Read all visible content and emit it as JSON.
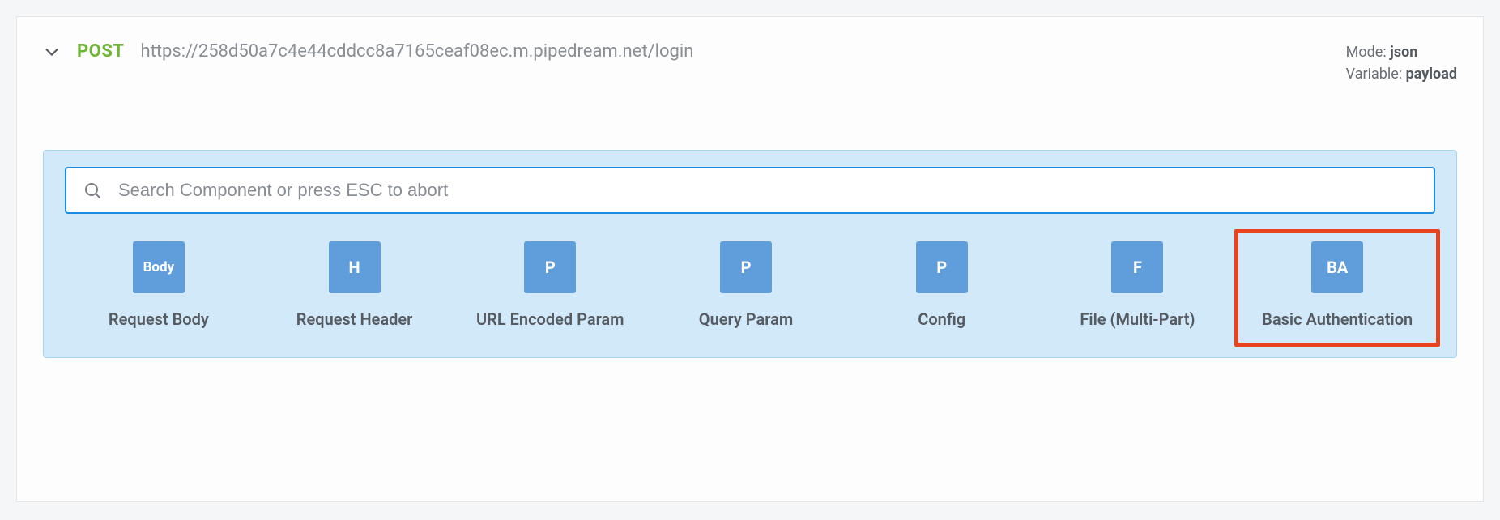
{
  "header": {
    "method": "POST",
    "url": "https://258d50a7c4e44cddcc8a7165ceaf08ec.m.pipedream.net/login",
    "mode_label": "Mode: ",
    "mode_value": "json",
    "variable_label": "Variable: ",
    "variable_value": "payload"
  },
  "search": {
    "placeholder": "Search Component or press ESC to abort"
  },
  "components": [
    {
      "badge": "Body",
      "label": "Request Body"
    },
    {
      "badge": "H",
      "label": "Request Header"
    },
    {
      "badge": "P",
      "label": "URL Encoded Param"
    },
    {
      "badge": "P",
      "label": "Query Param"
    },
    {
      "badge": "P",
      "label": "Config"
    },
    {
      "badge": "F",
      "label": "File (Multi-Part)"
    },
    {
      "badge": "BA",
      "label": "Basic Authentication"
    }
  ]
}
